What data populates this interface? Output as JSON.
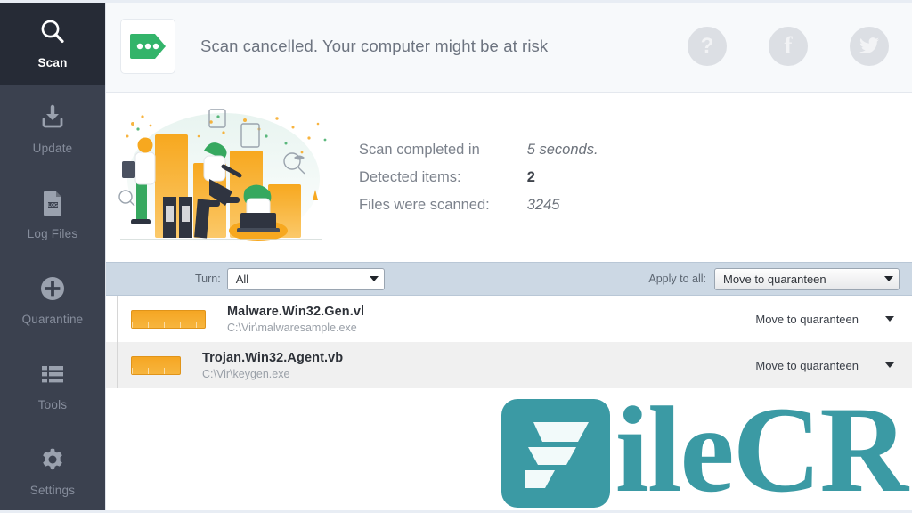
{
  "sidebar": {
    "items": [
      {
        "id": "scan",
        "label": "Scan",
        "icon": "search-icon",
        "active": true
      },
      {
        "id": "update",
        "label": "Update",
        "icon": "download-icon",
        "active": false
      },
      {
        "id": "logfiles",
        "label": "Log Files",
        "icon": "log-file-icon",
        "active": false
      },
      {
        "id": "quarantine",
        "label": "Quarantine",
        "icon": "plus-circle-icon",
        "active": false
      },
      {
        "id": "tools",
        "label": "Tools",
        "icon": "list-icon",
        "active": false
      },
      {
        "id": "settings",
        "label": "Settings",
        "icon": "gear-icon",
        "active": false
      }
    ]
  },
  "header": {
    "status_icon": "green-tag-dots-icon",
    "status_text": "Scan cancelled. Your computer might be at risk",
    "actions": [
      {
        "id": "help",
        "icon": "question-mark-icon",
        "glyph": "?"
      },
      {
        "id": "facebook",
        "icon": "facebook-icon",
        "glyph": "f"
      },
      {
        "id": "twitter",
        "icon": "twitter-icon",
        "glyph": ""
      }
    ]
  },
  "summary": {
    "illustration": "people-and-bar-chart-illustration",
    "rows": [
      {
        "label": "Scan completed in",
        "value": "5 seconds.",
        "strong": false
      },
      {
        "label": "Detected items:",
        "value": "2",
        "strong": true
      },
      {
        "label": "Files were scanned:",
        "value": "3245",
        "strong": false
      }
    ]
  },
  "filterbar": {
    "filter_label": "Turn:",
    "filter_value": "All",
    "apply_label": "Apply to all:",
    "apply_value": "Move to quaranteen"
  },
  "results": {
    "rows": [
      {
        "name": "Malware.Win32.Gen.vl",
        "path": "C:\\Vir\\malwaresample.exe",
        "action": "Move to quaranteen",
        "chip_width": "w1",
        "alt": false
      },
      {
        "name": "Trojan.Win32.Agent.vb",
        "path": "C:\\Vir\\keygen.exe",
        "action": "Move to quaranteen",
        "chip_width": "w2",
        "alt": true
      }
    ]
  },
  "watermark": {
    "text": "ileCR",
    "mark": "filecr-f-logo",
    "color": "#3b9aa4"
  },
  "colors": {
    "sidebar_bg": "#3b414f",
    "sidebar_active_bg": "#262b36",
    "header_bg": "#f7f9fb",
    "filterbar_bg": "#ccd8e4",
    "accent_green": "#33b46a",
    "accent_orange": "#f5a623",
    "watermark_teal": "#3b9aa4"
  }
}
